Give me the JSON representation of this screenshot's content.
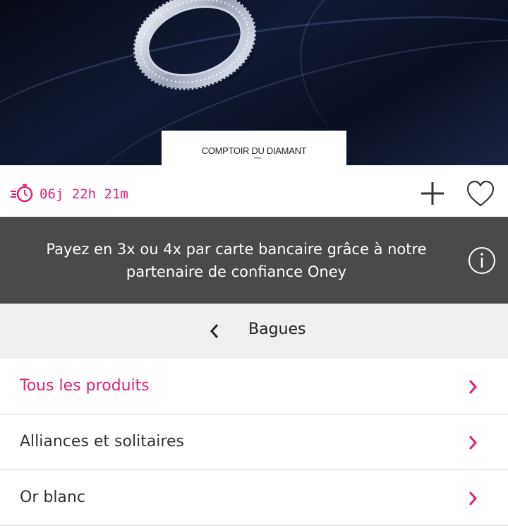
{
  "hero": {
    "brand_name": "COMPTOIR DU DIAMANT",
    "brand_sub": "PARIS"
  },
  "timer": {
    "text": "06j 22h 21m",
    "icon": "stopwatch-icon",
    "color": "#e0207a"
  },
  "actions": {
    "add_icon": "plus-icon",
    "favorite_icon": "heart-icon"
  },
  "banner": {
    "line1": "Payez en 3x ou 4x par carte bancaire grâce à notre",
    "line2": "partenaire de confiance Oney",
    "icon": "info-icon",
    "background": "#4a4a4a"
  },
  "category": {
    "title": "Bagues",
    "back_icon": "chevron-left-icon"
  },
  "list": [
    {
      "label": "Tous les produits",
      "active": true
    },
    {
      "label": "Alliances et solitaires",
      "active": false
    },
    {
      "label": "Or blanc",
      "active": false
    }
  ],
  "colors": {
    "accent": "#e0207a"
  }
}
